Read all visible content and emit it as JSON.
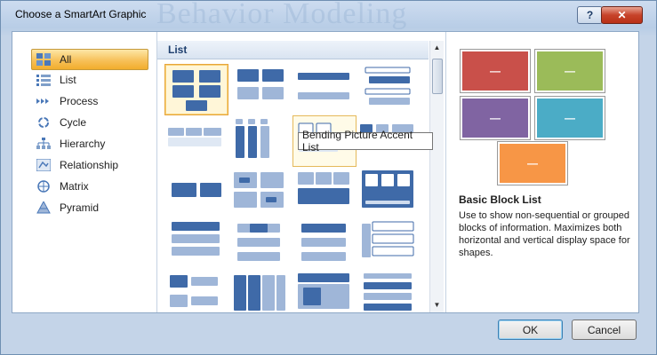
{
  "window": {
    "title": "Choose a SmartArt Graphic",
    "background_text": "Behavior Modeling",
    "help_label": "?",
    "close_label": "✕"
  },
  "categories": [
    {
      "label": "All",
      "icon": "all-icon",
      "selected": true
    },
    {
      "label": "List",
      "icon": "list-icon"
    },
    {
      "label": "Process",
      "icon": "process-icon"
    },
    {
      "label": "Cycle",
      "icon": "cycle-icon"
    },
    {
      "label": "Hierarchy",
      "icon": "hierarchy-icon"
    },
    {
      "label": "Relationship",
      "icon": "relationship-icon"
    },
    {
      "label": "Matrix",
      "icon": "matrix-icon"
    },
    {
      "label": "Pyramid",
      "icon": "pyramid-icon"
    }
  ],
  "gallery": {
    "header": "List",
    "selected_index": 0,
    "hover_index": 6,
    "tooltip": "Bending Picture Accent List"
  },
  "preview": {
    "box_colors": [
      "#c9504a",
      "#9bbb59",
      "#8064a2",
      "#4bacc6",
      "#f79646"
    ],
    "box_symbol": "—",
    "title": "Basic Block List",
    "description": "Use to show non-sequential or grouped blocks of information. Maximizes both horizontal and vertical display space for shapes."
  },
  "buttons": {
    "ok": "OK",
    "cancel": "Cancel"
  },
  "colors": {
    "thumb_dark": "#3f6aa8",
    "thumb_light": "#9fb6d8",
    "selection": "#f2ad2c"
  }
}
